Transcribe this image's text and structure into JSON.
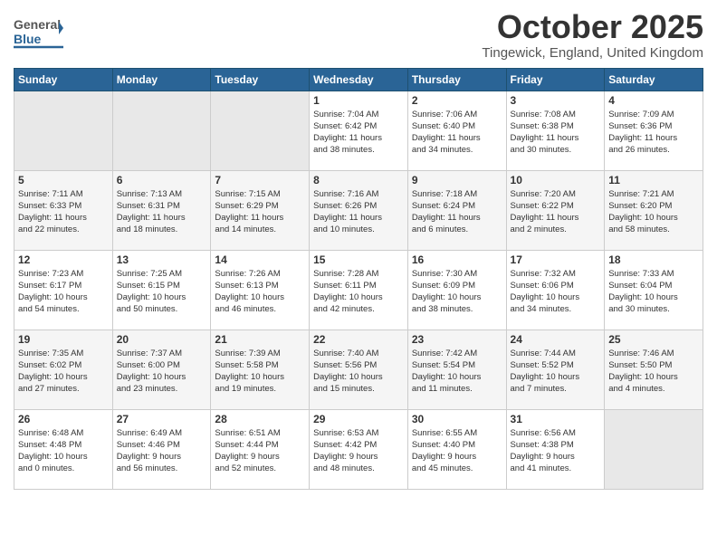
{
  "header": {
    "logo": {
      "line1": "General",
      "line2": "Blue"
    },
    "month": "October 2025",
    "location": "Tingewick, England, United Kingdom"
  },
  "weekdays": [
    "Sunday",
    "Monday",
    "Tuesday",
    "Wednesday",
    "Thursday",
    "Friday",
    "Saturday"
  ],
  "weeks": [
    [
      {
        "day": "",
        "info": ""
      },
      {
        "day": "",
        "info": ""
      },
      {
        "day": "",
        "info": ""
      },
      {
        "day": "1",
        "info": "Sunrise: 7:04 AM\nSunset: 6:42 PM\nDaylight: 11 hours\nand 38 minutes."
      },
      {
        "day": "2",
        "info": "Sunrise: 7:06 AM\nSunset: 6:40 PM\nDaylight: 11 hours\nand 34 minutes."
      },
      {
        "day": "3",
        "info": "Sunrise: 7:08 AM\nSunset: 6:38 PM\nDaylight: 11 hours\nand 30 minutes."
      },
      {
        "day": "4",
        "info": "Sunrise: 7:09 AM\nSunset: 6:36 PM\nDaylight: 11 hours\nand 26 minutes."
      }
    ],
    [
      {
        "day": "5",
        "info": "Sunrise: 7:11 AM\nSunset: 6:33 PM\nDaylight: 11 hours\nand 22 minutes."
      },
      {
        "day": "6",
        "info": "Sunrise: 7:13 AM\nSunset: 6:31 PM\nDaylight: 11 hours\nand 18 minutes."
      },
      {
        "day": "7",
        "info": "Sunrise: 7:15 AM\nSunset: 6:29 PM\nDaylight: 11 hours\nand 14 minutes."
      },
      {
        "day": "8",
        "info": "Sunrise: 7:16 AM\nSunset: 6:26 PM\nDaylight: 11 hours\nand 10 minutes."
      },
      {
        "day": "9",
        "info": "Sunrise: 7:18 AM\nSunset: 6:24 PM\nDaylight: 11 hours\nand 6 minutes."
      },
      {
        "day": "10",
        "info": "Sunrise: 7:20 AM\nSunset: 6:22 PM\nDaylight: 11 hours\nand 2 minutes."
      },
      {
        "day": "11",
        "info": "Sunrise: 7:21 AM\nSunset: 6:20 PM\nDaylight: 10 hours\nand 58 minutes."
      }
    ],
    [
      {
        "day": "12",
        "info": "Sunrise: 7:23 AM\nSunset: 6:17 PM\nDaylight: 10 hours\nand 54 minutes."
      },
      {
        "day": "13",
        "info": "Sunrise: 7:25 AM\nSunset: 6:15 PM\nDaylight: 10 hours\nand 50 minutes."
      },
      {
        "day": "14",
        "info": "Sunrise: 7:26 AM\nSunset: 6:13 PM\nDaylight: 10 hours\nand 46 minutes."
      },
      {
        "day": "15",
        "info": "Sunrise: 7:28 AM\nSunset: 6:11 PM\nDaylight: 10 hours\nand 42 minutes."
      },
      {
        "day": "16",
        "info": "Sunrise: 7:30 AM\nSunset: 6:09 PM\nDaylight: 10 hours\nand 38 minutes."
      },
      {
        "day": "17",
        "info": "Sunrise: 7:32 AM\nSunset: 6:06 PM\nDaylight: 10 hours\nand 34 minutes."
      },
      {
        "day": "18",
        "info": "Sunrise: 7:33 AM\nSunset: 6:04 PM\nDaylight: 10 hours\nand 30 minutes."
      }
    ],
    [
      {
        "day": "19",
        "info": "Sunrise: 7:35 AM\nSunset: 6:02 PM\nDaylight: 10 hours\nand 27 minutes."
      },
      {
        "day": "20",
        "info": "Sunrise: 7:37 AM\nSunset: 6:00 PM\nDaylight: 10 hours\nand 23 minutes."
      },
      {
        "day": "21",
        "info": "Sunrise: 7:39 AM\nSunset: 5:58 PM\nDaylight: 10 hours\nand 19 minutes."
      },
      {
        "day": "22",
        "info": "Sunrise: 7:40 AM\nSunset: 5:56 PM\nDaylight: 10 hours\nand 15 minutes."
      },
      {
        "day": "23",
        "info": "Sunrise: 7:42 AM\nSunset: 5:54 PM\nDaylight: 10 hours\nand 11 minutes."
      },
      {
        "day": "24",
        "info": "Sunrise: 7:44 AM\nSunset: 5:52 PM\nDaylight: 10 hours\nand 7 minutes."
      },
      {
        "day": "25",
        "info": "Sunrise: 7:46 AM\nSunset: 5:50 PM\nDaylight: 10 hours\nand 4 minutes."
      }
    ],
    [
      {
        "day": "26",
        "info": "Sunrise: 6:48 AM\nSunset: 4:48 PM\nDaylight: 10 hours\nand 0 minutes."
      },
      {
        "day": "27",
        "info": "Sunrise: 6:49 AM\nSunset: 4:46 PM\nDaylight: 9 hours\nand 56 minutes."
      },
      {
        "day": "28",
        "info": "Sunrise: 6:51 AM\nSunset: 4:44 PM\nDaylight: 9 hours\nand 52 minutes."
      },
      {
        "day": "29",
        "info": "Sunrise: 6:53 AM\nSunset: 4:42 PM\nDaylight: 9 hours\nand 48 minutes."
      },
      {
        "day": "30",
        "info": "Sunrise: 6:55 AM\nSunset: 4:40 PM\nDaylight: 9 hours\nand 45 minutes."
      },
      {
        "day": "31",
        "info": "Sunrise: 6:56 AM\nSunset: 4:38 PM\nDaylight: 9 hours\nand 41 minutes."
      },
      {
        "day": "",
        "info": ""
      }
    ]
  ]
}
